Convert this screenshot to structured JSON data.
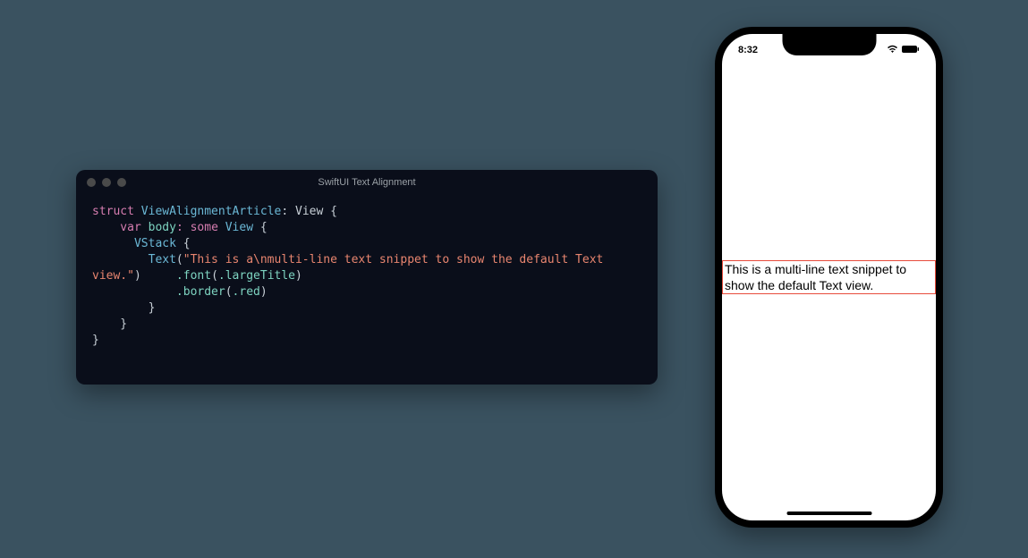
{
  "editor": {
    "title": "SwiftUI Text Alignment",
    "code": {
      "l1_struct": "struct",
      "l1_name": " ViewAlignmentArticle",
      "l1_rest": ": View {",
      "l2_var": "    var",
      "l2_body": " body",
      "l2_some": ": some",
      "l2_view": " View",
      "l2_brace": " {",
      "l3_vstack": "      VStack",
      "l3_brace": " {",
      "l4_text": "        Text",
      "l4_open": "(",
      "l4_str": "\"This is a\\nmulti-line text snippet to show the default Text",
      "l5_str_cont": "view.\"",
      "l5_close": ")",
      "l5_font": "     .font",
      "l5_font_open": "(",
      "l5_font_arg": ".largeTitle",
      "l5_font_close": ")",
      "l6_border": "            .border",
      "l6_border_open": "(",
      "l6_border_arg": ".red",
      "l6_border_close": ")",
      "l7": "        }",
      "l8": "    }",
      "l9": "}"
    }
  },
  "phone": {
    "time": "8:32",
    "text_content": "This is a multi-line text snippet to show the default Text view."
  }
}
